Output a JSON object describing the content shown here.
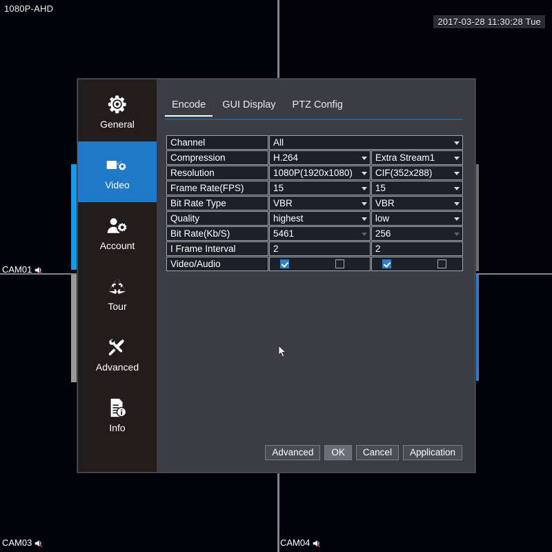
{
  "live_view": {
    "channel_title": "1080P-AHD",
    "datetime": "2017-03-28 11:30:28 Tue",
    "cameras": [
      {
        "label": "CAM01",
        "mute_icon": "speaker-muted-icon"
      },
      {
        "label": "CAM03",
        "mute_icon": "speaker-muted-icon"
      },
      {
        "label": "CAM04",
        "mute_icon": "speaker-muted-icon"
      }
    ]
  },
  "dialog": {
    "sidebar": {
      "items": [
        {
          "label": "General",
          "icon": "gear-icon",
          "active": false
        },
        {
          "label": "Video",
          "icon": "video-camera-gear-icon",
          "active": true
        },
        {
          "label": "Account",
          "icon": "user-gear-icon",
          "active": false
        },
        {
          "label": "Tour",
          "icon": "recycle-arrows-icon",
          "active": false
        },
        {
          "label": "Advanced",
          "icon": "wrench-screwdriver-icon",
          "active": false
        },
        {
          "label": "Info",
          "icon": "document-info-icon",
          "active": false
        }
      ]
    },
    "tabs": [
      {
        "label": "Encode",
        "active": true
      },
      {
        "label": "GUI Display",
        "active": false
      },
      {
        "label": "PTZ Config",
        "active": false
      }
    ],
    "form": {
      "rows": [
        {
          "label": "Channel",
          "main": {
            "value": "All",
            "control": "dropdown",
            "disabled": false
          },
          "extra": null,
          "span": true
        },
        {
          "label": "Compression",
          "main": {
            "value": "H.264",
            "control": "dropdown",
            "disabled": false
          },
          "extra": {
            "value": "Extra Stream1",
            "control": "dropdown",
            "disabled": false
          }
        },
        {
          "label": "Resolution",
          "main": {
            "value": "1080P(1920x1080)",
            "control": "dropdown",
            "disabled": false
          },
          "extra": {
            "value": "CIF(352x288)",
            "control": "dropdown",
            "disabled": false
          }
        },
        {
          "label": "Frame Rate(FPS)",
          "main": {
            "value": "15",
            "control": "dropdown",
            "disabled": false
          },
          "extra": {
            "value": "15",
            "control": "dropdown",
            "disabled": false
          }
        },
        {
          "label": "Bit Rate Type",
          "main": {
            "value": "VBR",
            "control": "dropdown",
            "disabled": false
          },
          "extra": {
            "value": "VBR",
            "control": "dropdown",
            "disabled": false
          }
        },
        {
          "label": "Quality",
          "main": {
            "value": "highest",
            "control": "dropdown",
            "disabled": false
          },
          "extra": {
            "value": "low",
            "control": "dropdown",
            "disabled": false
          }
        },
        {
          "label": "Bit Rate(Kb/S)",
          "main": {
            "value": "5461",
            "control": "dropdown",
            "disabled": true
          },
          "extra": {
            "value": "256",
            "control": "dropdown",
            "disabled": true
          }
        },
        {
          "label": "I Frame Interval",
          "main": {
            "value": "2",
            "control": "text",
            "disabled": false
          },
          "extra": {
            "value": "2",
            "control": "text",
            "disabled": false
          }
        },
        {
          "label": "Video/Audio",
          "main": {
            "control": "checkbox-pair",
            "video_checked": true,
            "audio_checked": false
          },
          "extra": {
            "control": "checkbox-pair",
            "video_checked": true,
            "audio_checked": false
          }
        }
      ]
    },
    "buttons": [
      {
        "label": "Advanced",
        "primary": false
      },
      {
        "label": "OK",
        "primary": true
      },
      {
        "label": "Cancel",
        "primary": false
      },
      {
        "label": "Application",
        "primary": false
      }
    ]
  },
  "colors": {
    "accent_blue": "#1f78c8",
    "dialog_bg": "#3c3d44",
    "sidebar_bg": "#231c1c",
    "field_bg": "#1c2028",
    "checkbox_on": "#2f7fd0",
    "disabled_text": "#6c7078"
  }
}
